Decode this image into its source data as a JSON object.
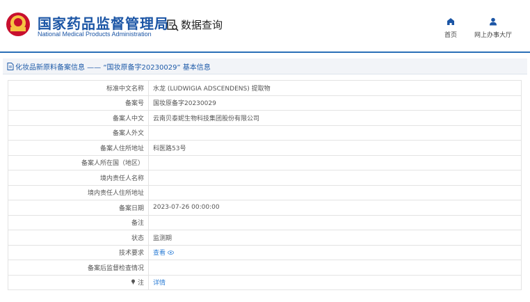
{
  "header": {
    "brand_cn": "国家药品监督管理局",
    "brand_en": "National Medical Products Administration",
    "search_title": "数据查询",
    "nav": [
      {
        "label": "首页",
        "icon": "home-icon"
      },
      {
        "label": "网上办事大厅",
        "icon": "user-icon"
      }
    ]
  },
  "section": {
    "title": "化妆品新原料备案信息 —— “国妆原备字20230029” 基本信息"
  },
  "rows": [
    {
      "label": "标准中文名称",
      "value": "水龙 (LUDWIGIA ADSCENDENS) 提取物"
    },
    {
      "label": "备案号",
      "value": "国妆原备字20230029"
    },
    {
      "label": "备案人中文",
      "value": "云南贝泰妮生物科技集团股份有限公司"
    },
    {
      "label": "备案人外文",
      "value": ""
    },
    {
      "label": "备案人住所地址",
      "value": "科医路53号"
    },
    {
      "label": "备案人所在国（地区）",
      "value": ""
    },
    {
      "label": "境内责任人名称",
      "value": ""
    },
    {
      "label": "境内责任人住所地址",
      "value": ""
    },
    {
      "label": "备案日期",
      "value": "2023-07-26 00:00:00"
    },
    {
      "label": "备注",
      "value": ""
    },
    {
      "label": "状态",
      "value": "监测期"
    },
    {
      "label": "技术要求",
      "value": "查看"
    },
    {
      "label": "备案后监督检查情况",
      "value": ""
    },
    {
      "label": "注",
      "value": "详情"
    }
  ],
  "colors": {
    "brand_blue": "#1b55a5",
    "link_blue": "#2f7fd6",
    "header_border": "#2a6fb7"
  }
}
